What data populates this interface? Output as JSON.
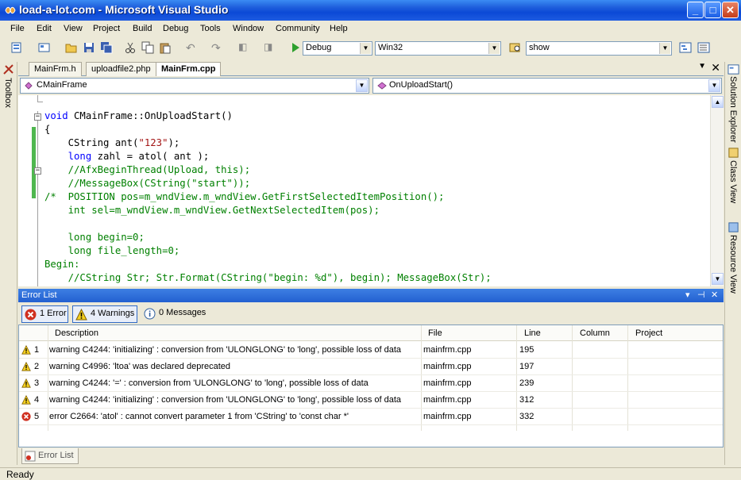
{
  "window": {
    "title": "load-a-lot.com - Microsoft Visual Studio",
    "minimize": "_",
    "maximize": "□",
    "close": "✕"
  },
  "menu": [
    "File",
    "Edit",
    "View",
    "Project",
    "Build",
    "Debug",
    "Tools",
    "Window",
    "Community",
    "Help"
  ],
  "toolbar": {
    "config": "Debug",
    "platform": "Win32",
    "find": "show"
  },
  "side": {
    "left": "Toolbox",
    "right": [
      "Solution Explorer",
      "Class View",
      "Resource View"
    ]
  },
  "tabs": [
    "MainFrm.h",
    "uploadfile2.php",
    "MainFrm.cpp"
  ],
  "active_tab": "MainFrm.cpp",
  "nav": {
    "class": "CMainFrame",
    "member": "OnUploadStart()"
  },
  "code": [
    [
      {
        "t": "void ",
        "c": "kw"
      },
      {
        "t": "CMainFrame::OnUploadStart()"
      }
    ],
    [
      {
        "t": "{"
      }
    ],
    [
      {
        "t": "    CString ant("
      },
      {
        "t": "\"123\"",
        "c": "st"
      },
      {
        "t": ");"
      }
    ],
    [
      {
        "t": "    "
      },
      {
        "t": "long",
        "c": "kw"
      },
      {
        "t": " zahl = atol( ant );"
      }
    ],
    [
      {
        "t": "    //AfxBeginThread(Upload, this);",
        "c": "cm"
      }
    ],
    [
      {
        "t": "    //MessageBox(CString(\"start\"));",
        "c": "cm"
      }
    ],
    [
      {
        "t": "/*  POSITION pos=m_wndView.m_wndView.GetFirstSelectedItemPosition();",
        "c": "cm"
      }
    ],
    [
      {
        "t": "    int sel=m_wndView.m_wndView.GetNextSelectedItem(pos);",
        "c": "cm"
      }
    ],
    [
      {
        "t": ""
      }
    ],
    [
      {
        "t": "    long begin=0;",
        "c": "cm"
      }
    ],
    [
      {
        "t": "    long file_length=0;",
        "c": "cm"
      }
    ],
    [
      {
        "t": "Begin:",
        "c": "cm"
      }
    ],
    [
      {
        "t": "    //CString Str; Str.Format(CString(\"begin: %d\"), begin); MessageBox(Str);",
        "c": "cm"
      }
    ]
  ],
  "error_list": {
    "title": "Error List",
    "filters": {
      "errors": "1 Error",
      "warnings": "4 Warnings",
      "messages": "0 Messages"
    },
    "columns": [
      "Description",
      "File",
      "Line",
      "Column",
      "Project"
    ],
    "rows": [
      {
        "type": "warning",
        "num": "1",
        "desc": "warning C4244: 'initializing' : conversion from 'ULONGLONG' to 'long', possible loss of data",
        "file": "mainfrm.cpp",
        "line": "195"
      },
      {
        "type": "warning",
        "num": "2",
        "desc": "warning C4996: 'ltoa' was declared deprecated",
        "file": "mainfrm.cpp",
        "line": "197"
      },
      {
        "type": "warning",
        "num": "3",
        "desc": "warning C4244: '=' : conversion from 'ULONGLONG' to 'long', possible loss of data",
        "file": "mainfrm.cpp",
        "line": "239"
      },
      {
        "type": "warning",
        "num": "4",
        "desc": "warning C4244: 'initializing' : conversion from 'ULONGLONG' to 'long', possible loss of data",
        "file": "mainfrm.cpp",
        "line": "312"
      },
      {
        "type": "error",
        "num": "5",
        "desc": "error C2664: 'atol' : cannot convert parameter 1 from 'CString' to 'const char *'",
        "file": "mainfrm.cpp",
        "line": "332"
      }
    ],
    "bottom_tab": "Error List"
  },
  "status": "Ready",
  "colors": {
    "keyword": "#0000ff",
    "comment": "#008000",
    "string": "#a31515",
    "titlebar": "#0b49d6"
  }
}
